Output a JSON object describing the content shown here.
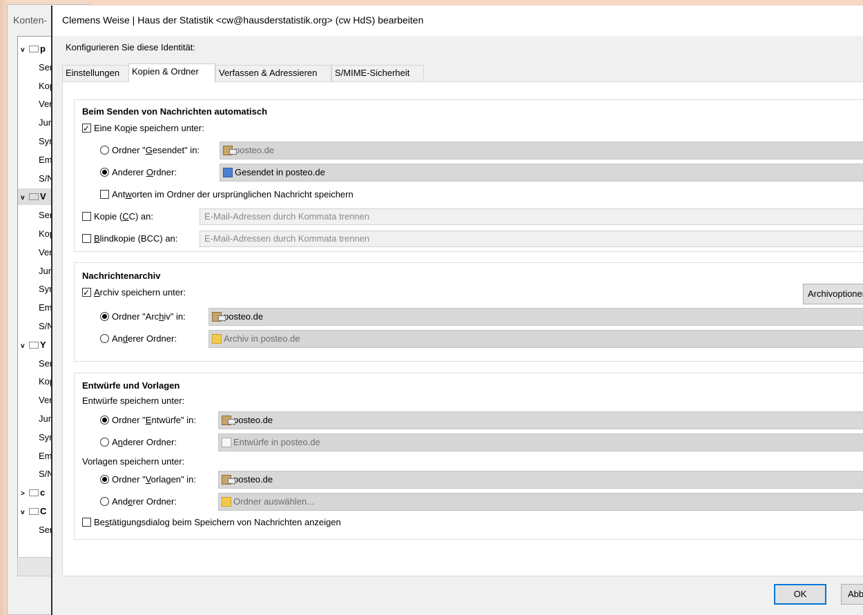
{
  "background_window": {
    "title": "Konten-",
    "tree": [
      {
        "type": "account",
        "chevron": "v",
        "label": "p",
        "selected": false
      },
      {
        "type": "sub",
        "label": "Ser"
      },
      {
        "type": "sub",
        "label": "Kop"
      },
      {
        "type": "sub",
        "label": "Ver"
      },
      {
        "type": "sub",
        "label": "Jun"
      },
      {
        "type": "sub",
        "label": "Syr"
      },
      {
        "type": "sub",
        "label": "Em"
      },
      {
        "type": "sub",
        "label": "S/N"
      },
      {
        "type": "account",
        "chevron": "v",
        "label": "V",
        "selected": true
      },
      {
        "type": "sub",
        "label": "Ser"
      },
      {
        "type": "sub",
        "label": "Kop"
      },
      {
        "type": "sub",
        "label": "Ver"
      },
      {
        "type": "sub",
        "label": "Jun"
      },
      {
        "type": "sub",
        "label": "Syr"
      },
      {
        "type": "sub",
        "label": "Em"
      },
      {
        "type": "sub",
        "label": "S/N"
      },
      {
        "type": "account",
        "chevron": "v",
        "label": "Y",
        "selected": false
      },
      {
        "type": "sub",
        "label": "Ser"
      },
      {
        "type": "sub",
        "label": "Kop"
      },
      {
        "type": "sub",
        "label": "Ver"
      },
      {
        "type": "sub",
        "label": "Jun"
      },
      {
        "type": "sub",
        "label": "Syr"
      },
      {
        "type": "sub",
        "label": "Em"
      },
      {
        "type": "sub",
        "label": "S/N"
      },
      {
        "type": "account",
        "chevron": ">",
        "label": "c",
        "selected": false
      },
      {
        "type": "account",
        "chevron": "v",
        "label": "C",
        "selected": false
      },
      {
        "type": "sub",
        "label": "Ser"
      }
    ]
  },
  "dialog": {
    "title": "Clemens Weise | Haus der Statistik <cw@hausderstatistik.org> (cw HdS) bearbeiten",
    "configure_label": "Konfigurieren Sie diese Identität:",
    "tabs": [
      {
        "label": "Einstellungen",
        "active": false
      },
      {
        "label": "Kopien & Ordner",
        "active": true
      },
      {
        "label": "Verfassen & Adressieren",
        "active": false
      },
      {
        "label": "S/MIME-Sicherheit",
        "active": false
      }
    ],
    "sending": {
      "title": "Beim Senden von Nachrichten automatisch",
      "save_copy": {
        "pre": "Eine Ko",
        "u": "p",
        "post": "ie speichern unter:",
        "checked": true
      },
      "sent_folder_radio": {
        "pre": "Ordner \"",
        "u": "G",
        "post": "esendet\" in:",
        "checked": false
      },
      "sent_folder_value": "posteo.de",
      "other_folder_radio": {
        "pre": "Anderer ",
        "u": "O",
        "post": "rdner:",
        "checked": true
      },
      "other_folder_value": "Gesendet in posteo.de",
      "reply_in_folder": {
        "pre": "Ant",
        "u": "w",
        "post": "orten im Ordner der ursprünglichen Nachricht speichern",
        "checked": false
      },
      "cc": {
        "pre": "Kopie (",
        "u": "C",
        "post": "C) an:",
        "checked": false
      },
      "cc_placeholder": "E-Mail-Adressen durch Kommata trennen",
      "bcc": {
        "pre": "",
        "u": "B",
        "post": "lindkopie (BCC) an:",
        "checked": false
      },
      "bcc_placeholder": "E-Mail-Adressen durch Kommata trennen"
    },
    "archive": {
      "title": "Nachrichtenarchiv",
      "save_archive": {
        "pre": "",
        "u": "A",
        "post": "rchiv speichern unter:",
        "checked": true
      },
      "options_button": "Archivoptionen...",
      "archive_folder_radio": {
        "pre": "Ordner \"Arc",
        "u": "h",
        "post": "iv\" in:",
        "checked": true
      },
      "archive_folder_value": "posteo.de",
      "other_folder_radio": {
        "pre": "An",
        "u": "d",
        "post": "erer Ordner:",
        "checked": false
      },
      "other_folder_value": "Archiv in posteo.de"
    },
    "drafts": {
      "title": "Entwürfe und Vorlagen",
      "drafts_label": "Entwürfe speichern unter:",
      "drafts_folder_radio": {
        "pre": "Ordner \"",
        "u": "E",
        "post": "ntwürfe\" in:",
        "checked": true
      },
      "drafts_folder_value": "posteo.de",
      "drafts_other_radio": {
        "pre": "A",
        "u": "n",
        "post": "derer Ordner:",
        "checked": false
      },
      "drafts_other_value": "Entwürfe in posteo.de",
      "templates_label": "Vorlagen speichern unter:",
      "templates_folder_radio": {
        "pre": "Ordner \"",
        "u": "V",
        "post": "orlagen\" in:",
        "checked": true
      },
      "templates_folder_value": "posteo.de",
      "templates_other_radio": {
        "pre": "And",
        "u": "e",
        "post": "rer Ordner:",
        "checked": false
      },
      "templates_other_value": "Ordner auswählen...",
      "confirm": {
        "pre": "Be",
        "u": "s",
        "post": "tätigungsdialog beim Speichern von Nachrichten anzeigen",
        "checked": false
      }
    },
    "buttons": {
      "ok": "OK",
      "cancel": "Abbrechen"
    }
  }
}
